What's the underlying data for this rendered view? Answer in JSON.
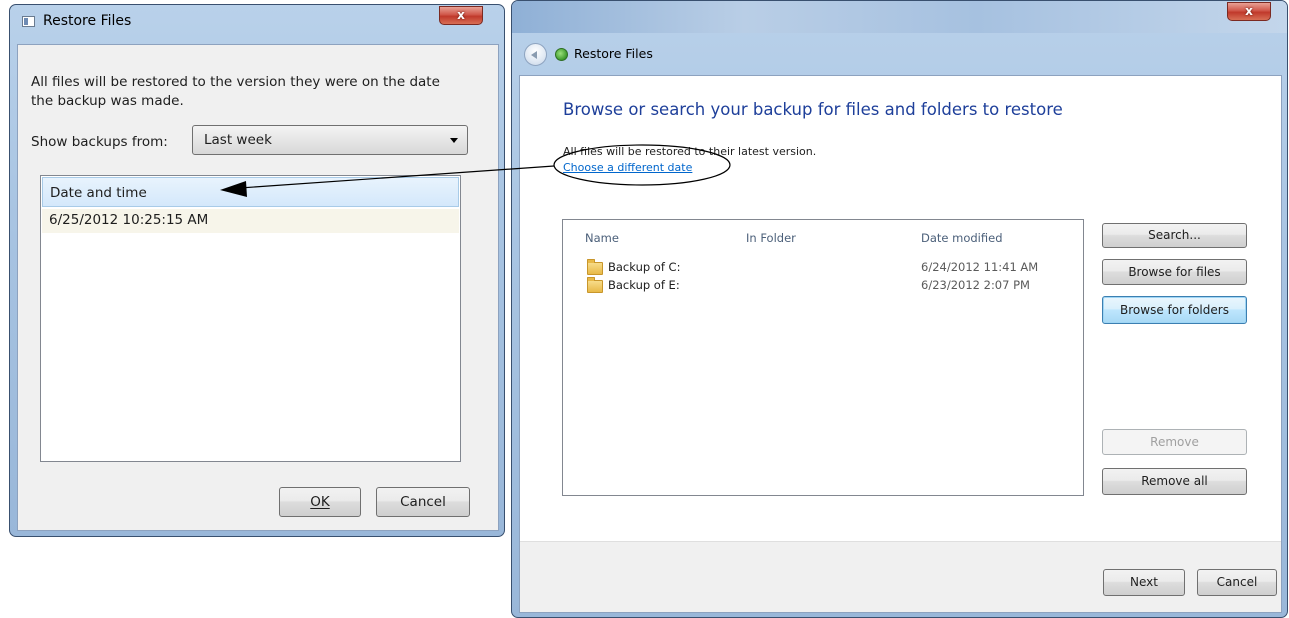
{
  "left_dialog": {
    "title": "Restore Files",
    "close_label": "x",
    "description": "All files will be restored to the version they were on the date the backup was made.",
    "show_backups_label": "Show backups from:",
    "show_backups_value": "Last week",
    "list_header": "Date and time",
    "backups": [
      "6/25/2012 10:25:15 AM"
    ],
    "ok_label": "OK",
    "cancel_label": "Cancel"
  },
  "right_window": {
    "close_label": "x",
    "nav_title": "Restore Files",
    "heading": "Browse or search your backup for files and folders to restore",
    "info_text": "All files will be restored to their latest version.",
    "link_text": "Choose a different date",
    "columns": [
      "Name",
      "In Folder",
      "Date modified"
    ],
    "rows": [
      {
        "name": "Backup of C:",
        "folder": "",
        "date": "6/24/2012 11:41 AM"
      },
      {
        "name": "Backup of E:",
        "folder": "",
        "date": "6/23/2012 2:07 PM"
      }
    ],
    "buttons": {
      "search": "Search...",
      "browse_files": "Browse for files",
      "browse_folders": "Browse for folders",
      "remove": "Remove",
      "remove_all": "Remove all",
      "next": "Next",
      "cancel": "Cancel"
    }
  },
  "colors": {
    "heading_blue": "#1e3f9a",
    "link_blue": "#0066cc",
    "header_highlight": "#dcecfc"
  }
}
